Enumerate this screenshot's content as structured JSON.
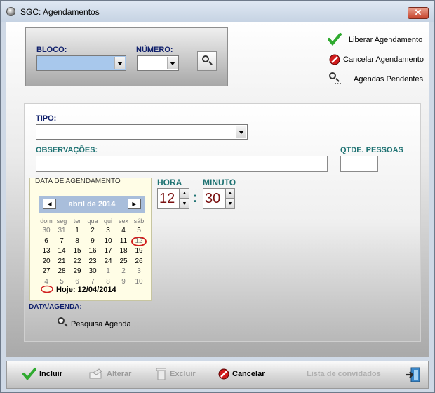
{
  "window": {
    "title": "SGC: Agendamentos",
    "close_label": "✕"
  },
  "filter": {
    "bloco_label": "BLOCO:",
    "numero_label": "NÚMERO:",
    "bloco_value": "",
    "numero_value": ""
  },
  "side_actions": {
    "liberar": "Liberar Agendamento",
    "cancelar": "Cancelar Agendamento",
    "pendentes": "Agendas Pendentes"
  },
  "form": {
    "tipo_label": "TIPO:",
    "tipo_value": "",
    "obs_label": "OBSERVAÇÕES:",
    "obs_value": "",
    "qtde_label": "QTDE. PESSOAS",
    "qtde_value": "",
    "hora_label": "HORA",
    "minuto_label": "MINUTO",
    "hora_value": "12",
    "minuto_value": "30",
    "data_agenda_label": "DATA/AGENDA:",
    "pesquisa_label": "Pesquisa Agenda"
  },
  "calendar": {
    "legend": "DATA DE AGENDAMENTO",
    "month": "abril de 2014",
    "prev_glyph": "◀",
    "next_glyph": "▶",
    "weekdays": [
      "dom",
      "seg",
      "ter",
      "qua",
      "qui",
      "sex",
      "sáb"
    ],
    "weeks": [
      [
        "30",
        "31",
        "1",
        "2",
        "3",
        "4",
        "5"
      ],
      [
        "6",
        "7",
        "8",
        "9",
        "10",
        "11",
        "12"
      ],
      [
        "13",
        "14",
        "15",
        "16",
        "17",
        "18",
        "19"
      ],
      [
        "20",
        "21",
        "22",
        "23",
        "24",
        "25",
        "26"
      ],
      [
        "27",
        "28",
        "29",
        "30",
        "1",
        "2",
        "3"
      ],
      [
        "4",
        "5",
        "6",
        "7",
        "8",
        "9",
        "10"
      ]
    ],
    "today_label": "Hoje: 12/04/2014"
  },
  "toolbar": {
    "incluir": "Incluir",
    "alterar": "Alterar",
    "excluir": "Excluir",
    "cancelar": "Cancelar",
    "lista": "Lista de convidados"
  }
}
